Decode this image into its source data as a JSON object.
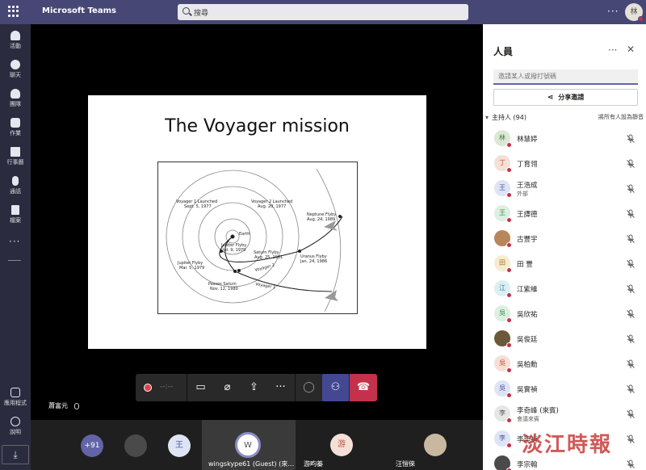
{
  "app": {
    "title": "Microsoft Teams"
  },
  "search": {
    "placeholder": "搜尋"
  },
  "user_avatar": "林",
  "rail": [
    {
      "label": "活動",
      "icon": "bell-icon"
    },
    {
      "label": "聊天",
      "icon": "chat-icon"
    },
    {
      "label": "團隊",
      "icon": "teams-icon"
    },
    {
      "label": "作業",
      "icon": "assignments-icon"
    },
    {
      "label": "行事曆",
      "icon": "calendar-icon"
    },
    {
      "label": "通話",
      "icon": "phone-icon"
    },
    {
      "label": "檔案",
      "icon": "file-icon"
    }
  ],
  "rail_bottom": [
    {
      "label": "應用程式",
      "icon": "apps-icon"
    },
    {
      "label": "說明",
      "icon": "help-icon"
    }
  ],
  "slide": {
    "title": "The Voyager mission",
    "labels": {
      "v1_launch": "Voyager 1 Launched",
      "v1_launch_date": "Sept. 5, 1977",
      "v2_launch": "Voyager 2 Launched",
      "v2_launch_date": "Aug. 20, 1977",
      "neptune": "Neptune Flyby",
      "neptune_date": "Aug. 24, 1989",
      "earth": "Earth",
      "jupiter_fb": "Jupiter Flyby",
      "jupiter_fb_date": "Jul. 9, 1979",
      "saturn_fb": "Saturn Flyby",
      "saturn_fb_date": "Aug. 25, 1981",
      "uranus": "Uranus Flyby",
      "uranus_date": "Jan. 24, 1986",
      "jupiter_fb2": "Jupiter Flyby",
      "jupiter_fb2_date": "Mar. 5, 1979",
      "voyager2": "Voyager 2",
      "passes_saturn": "Passes Saturn",
      "passes_saturn_date": "Nov. 12, 1980",
      "voyager1": "Voyager 1"
    }
  },
  "presenter": {
    "name": "蕭富元"
  },
  "controls": {
    "timer": "--:--"
  },
  "strip": {
    "overflow": "+91",
    "initial_wang": "王",
    "focus_initial": "W",
    "focus_label": "wingskype61 (Guest) (來…",
    "you_initial": "游",
    "you_label": "游畇蓁",
    "last_label": "汪愷倈"
  },
  "panel": {
    "title": "人員",
    "invite_placeholder": "邀請某人或撥打號碼",
    "share_label": "分享邀請",
    "section_label": "主持人 (94)",
    "mute_all": "將所有人設為靜音",
    "people": [
      {
        "initial": "林",
        "name": "林慧婷",
        "sub": "",
        "bg": "#dce8d5",
        "fg": "#4a7a3a"
      },
      {
        "initial": "丁",
        "name": "丁育翎",
        "sub": "",
        "bg": "#f6dfd7",
        "fg": "#b35a3a"
      },
      {
        "initial": "王",
        "name": "王浩成",
        "sub": "外部",
        "bg": "#dfe4f5",
        "fg": "#4a5aa0"
      },
      {
        "initial": "王",
        "name": "王譯德",
        "sub": "",
        "bg": "#dcefe0",
        "fg": "#3f8a52"
      },
      {
        "initial": "",
        "name": "古豐宇",
        "sub": "",
        "bg": "#b8865a",
        "fg": "#fff"
      },
      {
        "initial": "田",
        "name": "田 豐",
        "sub": "",
        "bg": "#f7ebd1",
        "fg": "#a37a2a"
      },
      {
        "initial": "江",
        "name": "江紫維",
        "sub": "",
        "bg": "#dceff3",
        "fg": "#2f8096"
      },
      {
        "initial": "吳",
        "name": "吳欣祐",
        "sub": "",
        "bg": "#dcefe0",
        "fg": "#3f8a52"
      },
      {
        "initial": "",
        "name": "吳俊廷",
        "sub": "",
        "bg": "#6b5a3a",
        "fg": "#fff"
      },
      {
        "initial": "吳",
        "name": "吳柏勳",
        "sub": "",
        "bg": "#f6dfd7",
        "fg": "#b35a3a"
      },
      {
        "initial": "吳",
        "name": "吳實禎",
        "sub": "",
        "bg": "#dfe4f5",
        "fg": "#4a5aa0"
      },
      {
        "initial": "李",
        "name": "李奇峰 (來賓)",
        "sub": "會議來賓",
        "bg": "#e6e6e6",
        "fg": "#555"
      },
      {
        "initial": "李",
        "name": "李奕禎",
        "sub": "",
        "bg": "#dfe4f5",
        "fg": "#4a5aa0"
      },
      {
        "initial": "",
        "name": "李宗翰",
        "sub": "",
        "bg": "#4a4a4a",
        "fg": "#fff"
      }
    ]
  },
  "watermark": "淡江時報"
}
